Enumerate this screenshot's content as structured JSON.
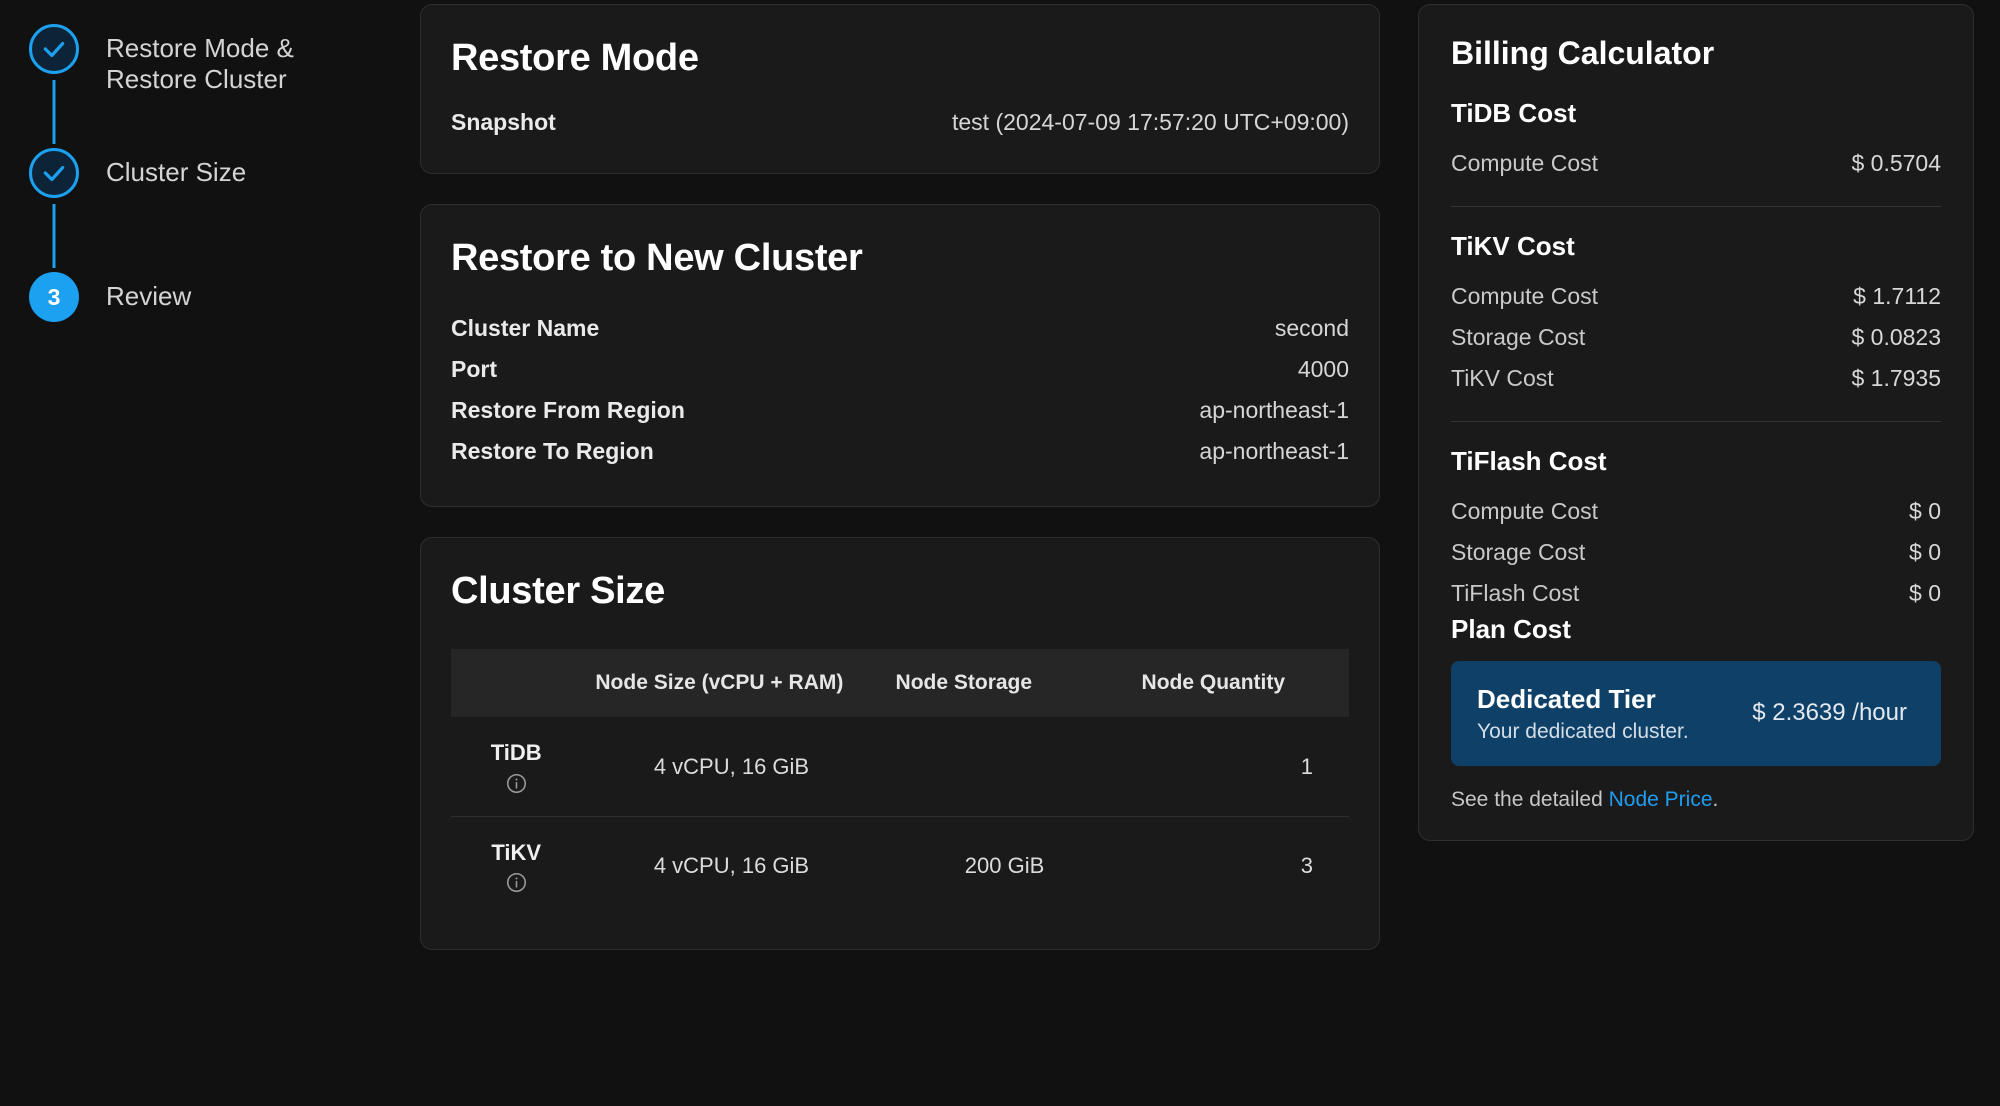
{
  "stepper": {
    "steps": [
      {
        "label": "Restore Mode &\nRestore Cluster",
        "state": "done",
        "icon": "check-icon"
      },
      {
        "label": "Cluster Size",
        "state": "done",
        "icon": "check-icon"
      },
      {
        "label": "Review",
        "state": "active",
        "number": "3"
      }
    ]
  },
  "restore_mode": {
    "title": "Restore Mode",
    "rows": [
      {
        "key": "Snapshot",
        "value": "test (2024-07-09 17:57:20 UTC+09:00)"
      }
    ]
  },
  "restore_to_new_cluster": {
    "title": "Restore to New Cluster",
    "rows": [
      {
        "key": "Cluster Name",
        "value": "second"
      },
      {
        "key": "Port",
        "value": "4000"
      },
      {
        "key": "Restore From Region",
        "value": "ap-northeast-1"
      },
      {
        "key": "Restore To Region",
        "value": "ap-northeast-1"
      }
    ]
  },
  "cluster_size": {
    "title": "Cluster Size",
    "columns": [
      "",
      "Node Size (vCPU + RAM)",
      "Node Storage",
      "Node Quantity"
    ],
    "rows": [
      {
        "type": "TiDB",
        "info_icon": "info-icon",
        "node_size": "4 vCPU, 16 GiB",
        "node_storage": "",
        "node_quantity": "1"
      },
      {
        "type": "TiKV",
        "info_icon": "info-icon",
        "node_size": "4 vCPU, 16 GiB",
        "node_storage": "200 GiB",
        "node_quantity": "3"
      }
    ]
  },
  "billing": {
    "title": "Billing Calculator",
    "groups": [
      {
        "heading": "TiDB Cost",
        "rows": [
          {
            "label": "Compute Cost",
            "amount": "$ 0.5704"
          }
        ]
      },
      {
        "heading": "TiKV Cost",
        "rows": [
          {
            "label": "Compute Cost",
            "amount": "$ 1.7112"
          },
          {
            "label": "Storage Cost",
            "amount": "$ 0.0823"
          },
          {
            "label": "TiKV Cost",
            "amount": "$ 1.7935"
          }
        ]
      },
      {
        "heading": "TiFlash Cost",
        "rows": [
          {
            "label": "Compute Cost",
            "amount": "$ 0"
          },
          {
            "label": "Storage Cost",
            "amount": "$ 0"
          },
          {
            "label": "TiFlash Cost",
            "amount": "$ 0"
          }
        ]
      }
    ],
    "plan_cost_heading": "Plan Cost",
    "tier": {
      "name": "Dedicated Tier",
      "description": "Your dedicated cluster.",
      "price": "$ 2.3639 /hour"
    },
    "footnote_prefix": "See the detailed ",
    "footnote_link": "Node Price",
    "footnote_suffix": ".",
    "accent_color": "#1e9df1",
    "tier_bg_color": "#0e4068"
  }
}
